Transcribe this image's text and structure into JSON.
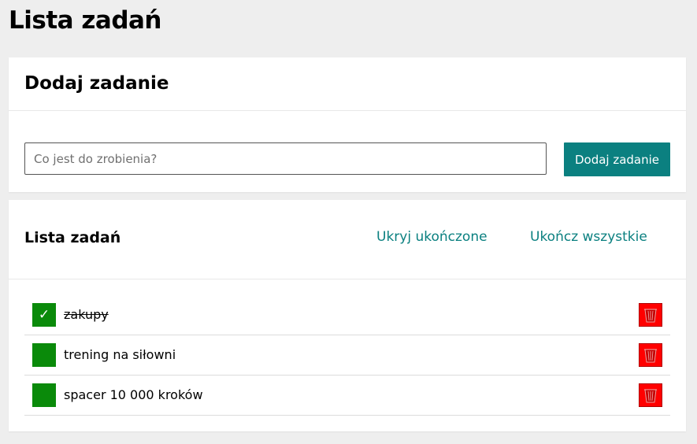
{
  "page": {
    "title": "Lista zadań"
  },
  "add_section": {
    "heading": "Dodaj zadanie",
    "input_value": "",
    "input_placeholder": "Co jest do zrobienia?",
    "button_label": "Dodaj zadanie"
  },
  "list_section": {
    "heading": "Lista zadań",
    "hide_completed_label": "Ukryj ukończone",
    "complete_all_label": "Ukończ wszystkie",
    "tasks": [
      {
        "text": "zakupy",
        "completed": true,
        "check_mark": "✓"
      },
      {
        "text": "trening na siłowni",
        "completed": false,
        "check_mark": ""
      },
      {
        "text": "spacer 10 000 kroków",
        "completed": false,
        "check_mark": ""
      }
    ],
    "delete_icon": "trash-icon"
  },
  "colors": {
    "accent": "#0b8080",
    "checkbox": "#0a8a0a",
    "delete": "#ff0000",
    "background": "#eeeeee"
  }
}
